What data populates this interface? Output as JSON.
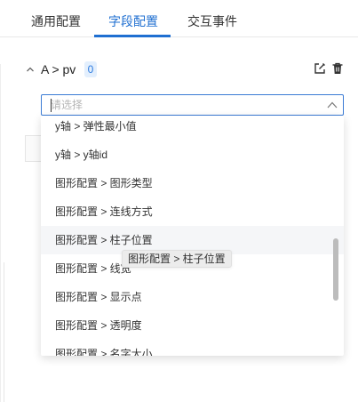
{
  "tabs": [
    {
      "label": "通用配置",
      "active": false
    },
    {
      "label": "字段配置",
      "active": true
    },
    {
      "label": "交互事件",
      "active": false
    }
  ],
  "field": {
    "title": "A > pv",
    "badge": "0",
    "icons": {
      "collapse": "chevron-up-icon",
      "edit": "edit-icon",
      "delete": "trash-icon"
    }
  },
  "select": {
    "placeholder": "请选择",
    "arrow_icon": "chevron-up-icon"
  },
  "dropdown": {
    "options": [
      {
        "label": "y轴 > 弹性最小值"
      },
      {
        "label": "y轴 > y轴id"
      },
      {
        "label": "图形配置 > 图形类型"
      },
      {
        "label": "图形配置 > 连线方式"
      },
      {
        "label": "图形配置 > 柱子位置",
        "hovered": true
      },
      {
        "label": "图形配置 > 线宽"
      },
      {
        "label": "图形配置 > 显示点"
      },
      {
        "label": "图形配置 > 透明度"
      },
      {
        "label": "图形配置 > 名字大小"
      }
    ]
  },
  "tooltip": {
    "text": "图形配置 > 柱子位置"
  },
  "colors": {
    "accent": "#1f6fd1",
    "badge_bg": "#e3effd",
    "badge_text": "#2d7be0",
    "hover_bg": "#f5f6f8",
    "tooltip_bg": "#ececec"
  }
}
